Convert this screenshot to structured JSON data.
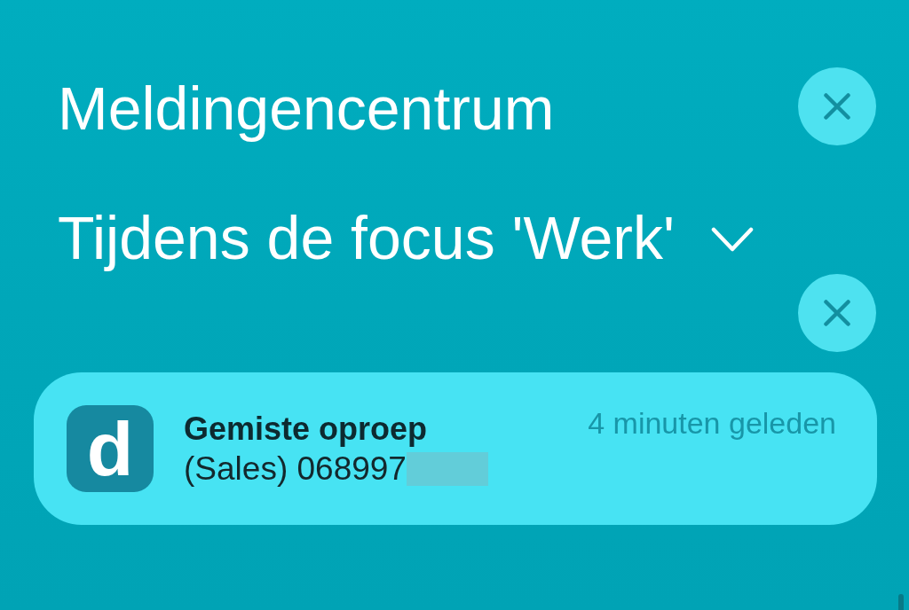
{
  "header": {
    "title": "Meldingencentrum"
  },
  "focus_group": {
    "title": "Tijdens de focus 'Werk'",
    "expanded": false
  },
  "notifications": [
    {
      "app_icon": "d",
      "title": "Gemiste oproep",
      "body": "(Sales) 068997",
      "time": "4 minuten geleden",
      "redacted": true
    }
  ]
}
